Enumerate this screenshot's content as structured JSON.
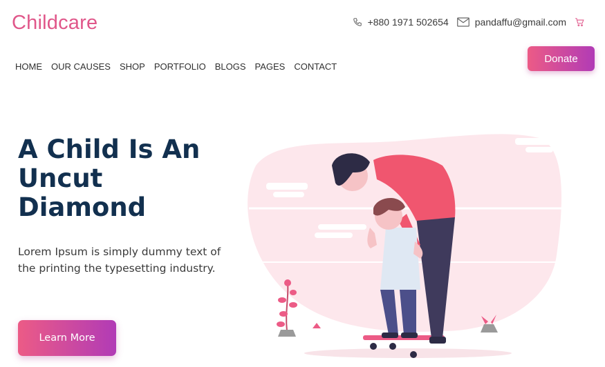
{
  "brand": {
    "logo": "Childcare",
    "accent": "#e0578a"
  },
  "contact": {
    "phone_icon": "phone-icon",
    "phone": "+880 1971 502654",
    "email_icon": "mail-icon",
    "email": "pandaffu@gmail.com",
    "cart_icon": "cart-icon"
  },
  "nav": {
    "items": [
      {
        "label": "HOME"
      },
      {
        "label": "OUR CAUSES"
      },
      {
        "label": "SHOP"
      },
      {
        "label": "PORTFOLIO"
      },
      {
        "label": "BLOGS"
      },
      {
        "label": "PAGES"
      },
      {
        "label": "CONTACT"
      }
    ]
  },
  "header": {
    "donate_label": "Donate"
  },
  "hero": {
    "title_line1": "A Child Is An",
    "title_line2": "Uncut",
    "title_line3": "Diamond",
    "description": "Lorem Ipsum is simply dummy text of the printing the typesetting industry.",
    "cta_label": "Learn More"
  },
  "colors": {
    "heading": "#12304f",
    "gradient_start": "#ec5b86",
    "gradient_end": "#b13bb6",
    "blob": "#fde7ec"
  }
}
